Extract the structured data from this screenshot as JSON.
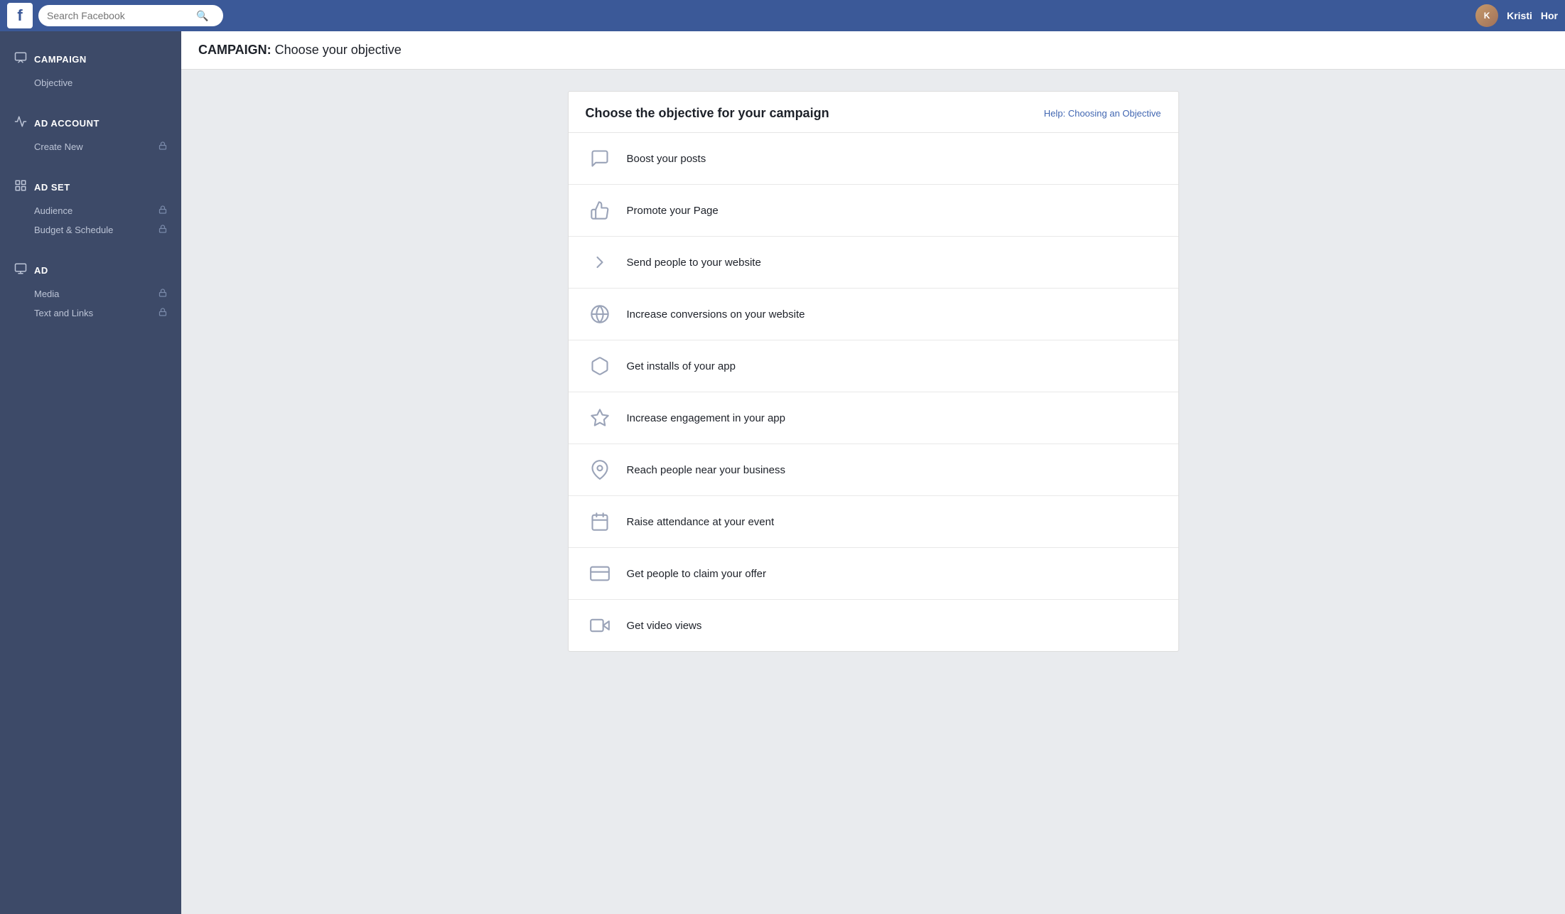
{
  "navbar": {
    "logo": "f",
    "search_placeholder": "Search Facebook",
    "user_name": "Kristi",
    "home_label": "Hor"
  },
  "page_title_bold": "CAMPAIGN:",
  "page_title_rest": " Choose your objective",
  "sidebar": {
    "sections": [
      {
        "id": "campaign",
        "icon": "✉",
        "label": "CAMPAIGN",
        "items": [
          {
            "label": "Objective",
            "locked": false
          }
        ]
      },
      {
        "id": "ad-account",
        "icon": "📣",
        "label": "AD ACCOUNT",
        "items": [
          {
            "label": "Create New",
            "locked": true
          }
        ]
      },
      {
        "id": "ad-set",
        "icon": "⊞",
        "label": "AD SET",
        "items": [
          {
            "label": "Audience",
            "locked": true
          },
          {
            "label": "Budget & Schedule",
            "locked": true
          }
        ]
      },
      {
        "id": "ad",
        "icon": "🖥",
        "label": "AD",
        "items": [
          {
            "label": "Media",
            "locked": true
          },
          {
            "label": "Text and Links",
            "locked": true
          }
        ]
      }
    ]
  },
  "objective_card": {
    "title": "Choose the objective for your campaign",
    "help_link": "Help: Choosing an Objective",
    "objectives": [
      {
        "id": "boost-posts",
        "label": "Boost your posts",
        "icon": "🗒"
      },
      {
        "id": "promote-page",
        "label": "Promote your Page",
        "icon": "👍"
      },
      {
        "id": "send-to-website",
        "label": "Send people to your website",
        "icon": "↗"
      },
      {
        "id": "increase-conversions",
        "label": "Increase conversions on your website",
        "icon": "🌐"
      },
      {
        "id": "app-installs",
        "label": "Get installs of your app",
        "icon": "📦"
      },
      {
        "id": "app-engagement",
        "label": "Increase engagement in your app",
        "icon": "🎮"
      },
      {
        "id": "reach-local",
        "label": "Reach people near your business",
        "icon": "📍"
      },
      {
        "id": "event-attendance",
        "label": "Raise attendance at your event",
        "icon": "📅"
      },
      {
        "id": "claim-offer",
        "label": "Get people to claim your offer",
        "icon": "🎫"
      },
      {
        "id": "video-views",
        "label": "Get video views",
        "icon": "🎬"
      }
    ]
  }
}
